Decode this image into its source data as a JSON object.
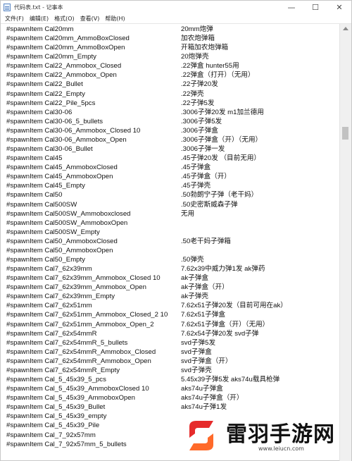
{
  "window": {
    "title": "代码表.txt - 记事本",
    "minimize_glyph": "—",
    "maximize_glyph": "☐",
    "close_glyph": "✕"
  },
  "menu": [
    "文件(F)",
    "编辑(E)",
    "格式(O)",
    "查看(V)",
    "帮助(H)"
  ],
  "lines": [
    {
      "code": "#spawnItem Cal20mm",
      "desc": "20mm炮弹"
    },
    {
      "code": "#spawnItem Cal20mm_AmmoBoxClosed",
      "desc": "加农炮弹箱"
    },
    {
      "code": "#spawnItem Cal20mm_AmmoBoxOpen",
      "desc": "开箱加农炮弹箱"
    },
    {
      "code": "#spawnItem Cal20mm_Empty",
      "desc": "20炮弹壳"
    },
    {
      "code": "#spawnItem Cal22_Ammobox_Closed",
      "desc": ".22弹盒 hunter55用"
    },
    {
      "code": "#spawnItem Cal22_Ammobox_Open",
      "desc": ".22弹盒（打开）（无用）"
    },
    {
      "code": "#spawnItem Cal22_Bullet",
      "desc": ".22子弹20发"
    },
    {
      "code": "#spawnItem Cal22_Empty",
      "desc": ".22弹壳"
    },
    {
      "code": "#spawnItem Cal22_Pile_5pcs",
      "desc": ".22子弹5发"
    },
    {
      "code": "#spawnItem Cal30-06",
      "desc": ".3006子弹20发 m1加兰德用"
    },
    {
      "code": "#spawnItem Cal30-06_5_bullets",
      "desc": ".3006子弹5发"
    },
    {
      "code": "#spawnItem Cal30-06_Ammobox_Closed 10",
      "desc": ".3006子弹盒"
    },
    {
      "code": "#spawnItem Cal30-06_Ammobox_Open",
      "desc": ".3006子弹盒（开）（无用）"
    },
    {
      "code": "#spawnItem Cal30-06_Bullet",
      "desc": ".3006子弹一发"
    },
    {
      "code": "#spawnItem Cal45",
      "desc": ".45子弹20发 （目前无用）"
    },
    {
      "code": "#spawnItem Cal45_AmmoboxClosed",
      "desc": ".45子弹盒"
    },
    {
      "code": "#spawnItem Cal45_AmmoboxOpen",
      "desc": ".45子弹盒（开）"
    },
    {
      "code": "#spawnItem Cal45_Empty",
      "desc": ".45子弹壳"
    },
    {
      "code": "#spawnItem Cal50",
      "desc": ".50勃朗宁子弹（老干妈）"
    },
    {
      "code": "#spawnItem Cal500SW",
      "desc": ".50史密斯威森子弹"
    },
    {
      "code": "#spawnItem Cal500SW_Ammoboxclosed",
      "desc": "无用"
    },
    {
      "code": "#spawnItem Cal500SW_AmmoboxOpen",
      "desc": ""
    },
    {
      "code": "#spawnItem Cal500SW_Empty",
      "desc": ""
    },
    {
      "code": "#spawnItem Cal50_AmmoboxClosed",
      "desc": ".50老干妈子弹箱"
    },
    {
      "code": "#spawnItem Cal50_AmmoboxOpen",
      "desc": ""
    },
    {
      "code": "#spawnItem Cal50_Empty",
      "desc": ".50弹壳"
    },
    {
      "code": "#spawnItem Cal7_62x39mm",
      "desc": "7.62x39中威力弹1发 ak弹药"
    },
    {
      "code": "#spawnItem Cal7_62x39mm_Ammobox_Closed 10",
      "desc": "ak子弹盒"
    },
    {
      "code": "#spawnItem Cal7_62x39mm_Ammobox_Open",
      "desc": "ak子弹盒（开）"
    },
    {
      "code": "#spawnItem Cal7_62x39mm_Empty",
      "desc": "ak子弹壳"
    },
    {
      "code": "#spawnItem Cal7_62x51mm",
      "desc": "7.62x51子弹20发（目前可用在ak）"
    },
    {
      "code": "#spawnItem Cal7_62x51mm_Ammobox_Closed_2 10",
      "desc": "7.62x51子弹盒"
    },
    {
      "code": "#spawnItem Cal7_62x51mm_Ammobox_Open_2",
      "desc": "7.62x51子弹盒（开）（无用）"
    },
    {
      "code": "#spawnItem Cal7_62x54mmR",
      "desc": "7.62x54子弹20发 svd子弹"
    },
    {
      "code": "#spawnItem Cal7_62x54mmR_5_bullets",
      "desc": "svd子弹5发"
    },
    {
      "code": "#spawnItem Cal7_62x54mmR_Ammobox_Closed",
      "desc": "svd子弹盒"
    },
    {
      "code": "#spawnItem Cal7_62x54mmR_Ammobox_Open",
      "desc": "svd子弹盒（开）"
    },
    {
      "code": "#spawnItem Cal7_62x54mmR_Empty",
      "desc": "svd子弹壳"
    },
    {
      "code": "#spawnItem Cal_5_45x39_5_pcs",
      "desc": "5.45x39子弹5发 aks74u载具枪弹"
    },
    {
      "code": "#spawnItem Cal_5_45x39_AmmoboxClosed 10",
      "desc": "aks74u子弹盒"
    },
    {
      "code": "#spawnItem Cal_5_45x39_AmmoboxOpen",
      "desc": "aks74u子弹盒（开）"
    },
    {
      "code": "#spawnItem Cal_5_45x39_Bullet",
      "desc": "aks74u子弹1发"
    },
    {
      "code": "#spawnItem Cal_5_45x39_empty",
      "desc": ""
    },
    {
      "code": "#spawnItem Cal_5_45x39_Pile",
      "desc": ""
    },
    {
      "code": "#spawnItem Cal_7_92x57mm",
      "desc": ""
    },
    {
      "code": "#spawnItem Cal_7_92x57mm_5_bullets",
      "desc": ""
    }
  ],
  "watermark": {
    "title": "雷羽手游网",
    "url": "www.leiucn.com",
    "logo_colors": [
      "#e62b2b",
      "#ff6a2a"
    ]
  }
}
